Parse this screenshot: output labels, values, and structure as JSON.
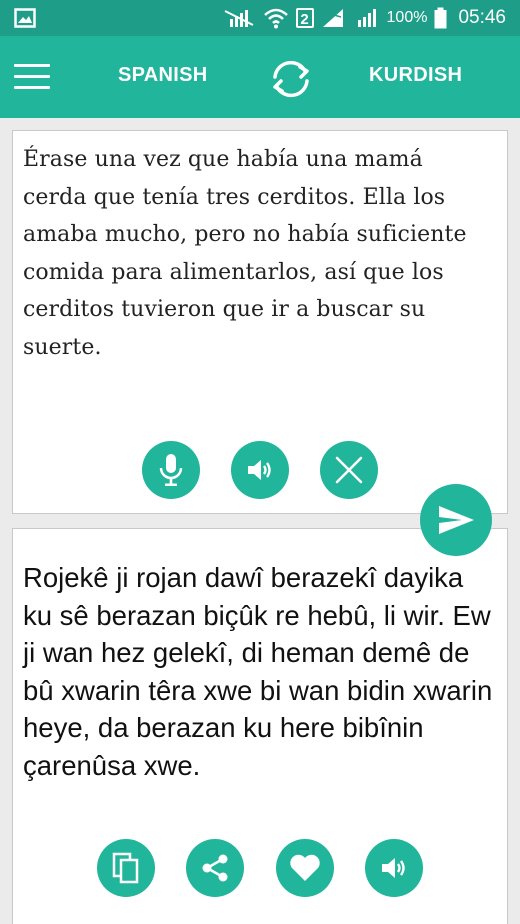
{
  "status_bar": {
    "sim_slot": "2",
    "battery": "100%",
    "time": "05:46"
  },
  "app_bar": {
    "source_language": "SPANISH",
    "target_language": "KURDISH"
  },
  "source_panel": {
    "text": "Érase una vez que había una mamá cerda que tenía tres cerditos. Ella los amaba mucho, pero no había suficiente comida para alimentarlos, así que los cerditos tuvieron que ir a buscar su suerte."
  },
  "target_panel": {
    "text": "Rojekê ji rojan dawî berazekî dayika ku sê berazan biçûk re hebû, li wir. Ew ji wan hez gelekî, di heman demê de bû xwarin têra xwe bi wan bidin xwarin heye, da berazan ku here bibînin çarenûsa xwe."
  },
  "colors": {
    "status_bar": "#1e9e88",
    "app_bar": "#21b59b",
    "accent": "#21b59b",
    "background": "#ebebeb"
  }
}
